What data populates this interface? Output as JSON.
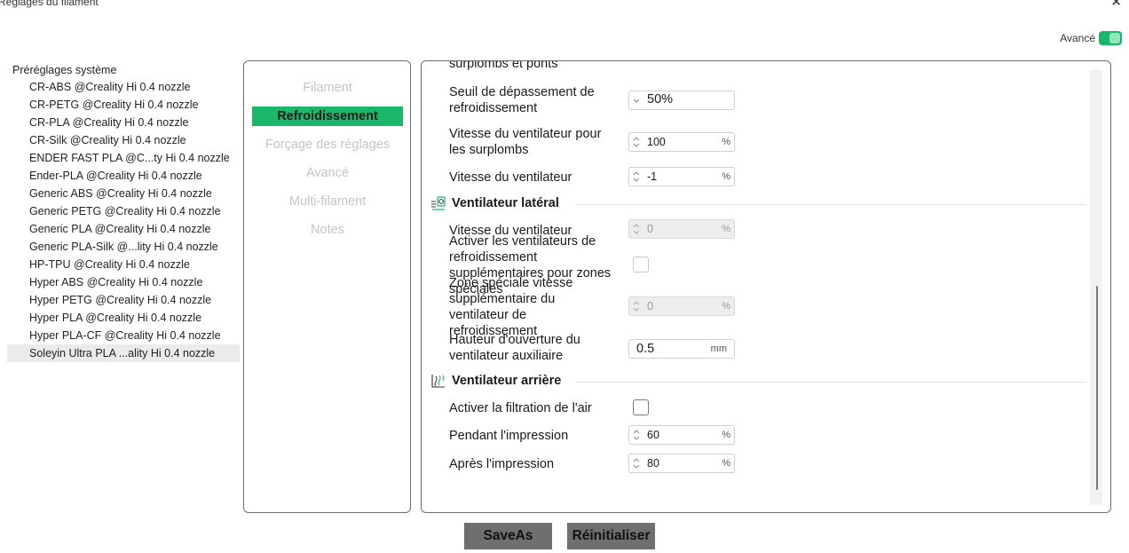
{
  "window": {
    "title": "Réglages du filament",
    "close_glyph": "✕"
  },
  "advanced_toggle": {
    "label": "Avancé",
    "on": true
  },
  "presets": {
    "group_label": "Préréglages système",
    "items": [
      "CR-ABS @Creality Hi 0.4 nozzle",
      "CR-PETG @Creality Hi 0.4 nozzle",
      "CR-PLA @Creality Hi 0.4 nozzle",
      "CR-Silk @Creality Hi 0.4 nozzle",
      "ENDER FAST PLA @C...ty Hi 0.4 nozzle",
      "Ender-PLA @Creality Hi 0.4 nozzle",
      "Generic ABS @Creality Hi 0.4 nozzle",
      "Generic PETG @Creality Hi 0.4 nozzle",
      "Generic PLA @Creality Hi 0.4 nozzle",
      "Generic PLA-Silk @...lity Hi 0.4 nozzle",
      "HP-TPU @Creality Hi 0.4 nozzle",
      "Hyper ABS @Creality Hi 0.4 nozzle",
      "Hyper PETG @Creality Hi 0.4 nozzle",
      "Hyper PLA @Creality Hi 0.4 nozzle",
      "Hyper PLA-CF @Creality Hi 0.4 nozzle",
      "Soleyin Ultra PLA ...ality Hi 0.4 nozzle"
    ],
    "selected_index": 15
  },
  "tabs": {
    "filament": "Filament",
    "cooling": "Refroidissement",
    "overrides": "Forçage des réglages",
    "advanced": "Avancé",
    "multi": "Multi-filament",
    "notes": "Notes",
    "active": "cooling"
  },
  "cooling": {
    "cut_off_text": "surplombs et ponts",
    "overhang_threshold": {
      "label_1": "Seuil de dépassement de",
      "label_2": "refroidissement",
      "value": "50%"
    },
    "overhang_fan_speed": {
      "label_1": "Vitesse du ventilateur pour",
      "label_2": "les surplombs",
      "value": "100",
      "unit": "%"
    },
    "fan_speed": {
      "label": "Vitesse du ventilateur",
      "value": "-1",
      "unit": "%"
    },
    "side_fan": {
      "title": "Ventilateur latéral",
      "icon": "side-fan-icon",
      "fan_speed": {
        "label": "Vitesse du ventilateur",
        "value": "0",
        "unit": "%"
      },
      "enable_special": {
        "label_1": "Activer les ventilateurs de",
        "label_2": "refroidissement",
        "label_3": "supplémentaires pour zones",
        "label_4": "spéciales"
      },
      "special_speed": {
        "label_1": "Zone spéciale vitesse",
        "label_2": "supplémentaire du",
        "label_3": "ventilateur de",
        "label_4": "refroidissement",
        "value": "0",
        "unit": "%"
      },
      "aux_height": {
        "label_1": "Hauteur d'ouverture du",
        "label_2": "ventilateur auxiliaire",
        "value": "0.5",
        "unit": "mm"
      }
    },
    "rear_fan": {
      "title": "Ventilateur arrière",
      "icon": "rear-fan-icon",
      "air_filtration": {
        "label": "Activer la filtration de l'air"
      },
      "during_print": {
        "label": "Pendant l'impression",
        "value": "60",
        "unit": "%"
      },
      "after_print": {
        "label": "Après l'impression",
        "value": "80",
        "unit": "%"
      }
    }
  },
  "buttons": {
    "save_as": "SaveAs",
    "reset": "Réinitialiser"
  },
  "colors": {
    "accent": "#1ab76a",
    "button": "#6f6f6f",
    "border": "#6e6e6e"
  }
}
